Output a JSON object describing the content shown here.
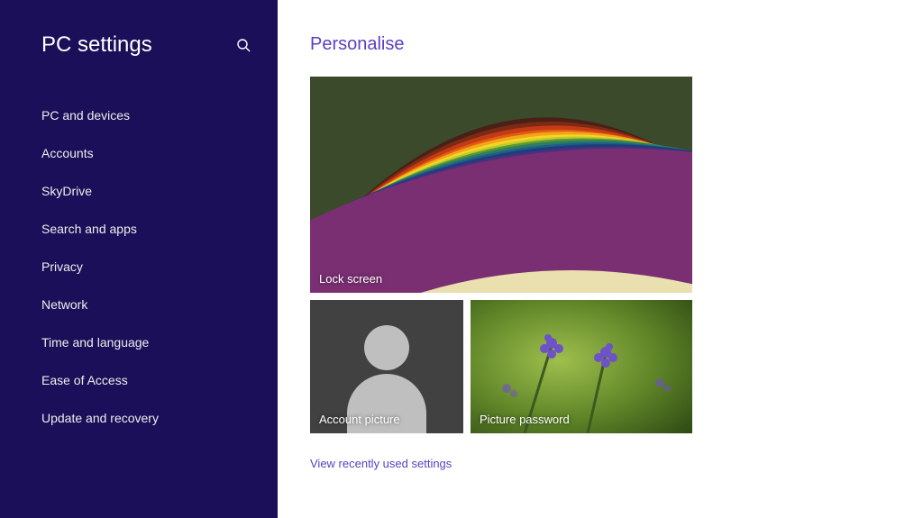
{
  "sidebar": {
    "title": "PC settings",
    "items": [
      {
        "label": "PC and devices"
      },
      {
        "label": "Accounts"
      },
      {
        "label": "SkyDrive"
      },
      {
        "label": "Search and apps"
      },
      {
        "label": "Privacy"
      },
      {
        "label": "Network"
      },
      {
        "label": "Time and language"
      },
      {
        "label": "Ease of Access"
      },
      {
        "label": "Update and recovery"
      }
    ]
  },
  "main": {
    "title": "Personalise",
    "tiles": {
      "lock_screen": {
        "label": "Lock screen"
      },
      "account_picture": {
        "label": "Account picture"
      },
      "picture_password": {
        "label": "Picture password"
      }
    },
    "view_recent_link": "View recently used settings"
  },
  "colors": {
    "sidebar_bg": "#1a0f58",
    "accent": "#5a3fc3"
  }
}
